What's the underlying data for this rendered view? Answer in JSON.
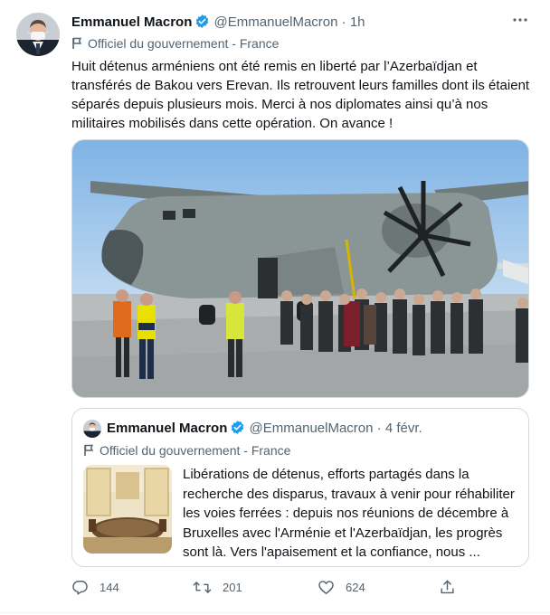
{
  "tweet": {
    "author_name": "Emmanuel Macron",
    "handle": "@EmmanuelMacron",
    "separator": "·",
    "time": "1h",
    "label": "Officiel du gouvernement - France",
    "text": "Huit détenus arméniens ont été remis en liberté par l’Azerbaïdjan et transférés de Bakou vers Erevan. Ils retrouvent leurs familles dont ils étaient séparés depuis plusieurs mois. Merci à nos diplomates ainsi qu’à nos militaires mobilisés dans cette opération. On avance !"
  },
  "quoted": {
    "author_name": "Emmanuel Macron",
    "handle": "@EmmanuelMacron",
    "separator": "·",
    "time": "4 févr.",
    "label": "Officiel du gouvernement - France",
    "text": "Libérations de détenus, efforts partagés dans la recherche des disparus, travaux à venir pour réhabiliter les voies ferrées : depuis nos réunions de décembre à Bruxelles avec l'Arménie et l'Azerbaïdjan, les progrès sont là. Vers l'apaisement et la confiance, nous ..."
  },
  "actions": {
    "reply_count": "144",
    "retweet_count": "201",
    "like_count": "624"
  },
  "icons": {
    "verified": "verified-badge-icon",
    "more": "more-options-icon",
    "flag": "government-flag-icon",
    "reply": "reply-icon",
    "retweet": "retweet-icon",
    "like": "like-icon",
    "share": "share-icon"
  },
  "colors": {
    "verified_blue": "#1d9bf0",
    "secondary_text": "#536471",
    "border": "#cfd9de"
  }
}
